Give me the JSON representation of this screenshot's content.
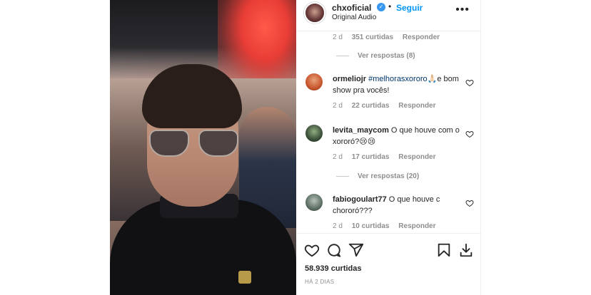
{
  "post": {
    "username": "chxoficial",
    "verified_mark": "✓",
    "separator": "•",
    "follow_label": "Seguir",
    "audio": "Original Audio",
    "more_label": "•••"
  },
  "comments_top_meta": {
    "time": "2 d",
    "likes": "351 curtidas",
    "reply": "Responder"
  },
  "view_replies_1": "Ver respostas (8)",
  "comments": [
    {
      "username": "ormeliojr",
      "tag": "#melhorasxororo",
      "text": "🙏🏻e bom show pra vocês!",
      "time": "2 d",
      "likes": "22 curtidas",
      "reply": "Responder",
      "avatar_color": "#c8562e"
    },
    {
      "username": "levita_maycom",
      "tag": "",
      "text": "O que houve com o xororó?😢😢",
      "time": "2 d",
      "likes": "17 curtidas",
      "reply": "Responder",
      "avatar_color": "#3b4f3a"
    },
    {
      "username": "fabiogoulart77",
      "tag": "",
      "text": "O que houve c chororó???",
      "time": "2 d",
      "likes": "10 curtidas",
      "reply": "Responder",
      "avatar_color": "#5d6f63"
    }
  ],
  "view_replies_2": "Ver respostas (20)",
  "footer": {
    "likes": "58.939 curtidas",
    "time_ago": "HÁ 2 DIAS"
  },
  "icons": {
    "heart": "heart-icon",
    "comment": "comment-icon",
    "share": "share-icon",
    "save": "bookmark-icon",
    "download": "download-icon"
  },
  "colors": {
    "follow": "#0095f6",
    "hashtag": "#00376b",
    "muted": "#8e8e8e",
    "verified": "#3897f0"
  }
}
